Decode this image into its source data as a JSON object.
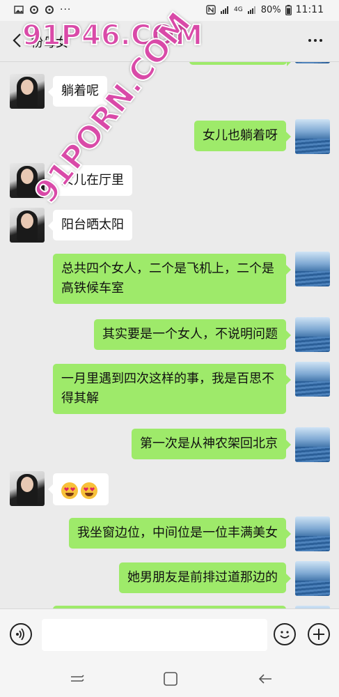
{
  "statusbar": {
    "battery": "80%",
    "time": "11:11",
    "network": "4G"
  },
  "header": {
    "title": "粉母女"
  },
  "messages": [
    {
      "side": "left",
      "text": "躺着呢"
    },
    {
      "side": "right",
      "text": "女儿也躺着呀"
    },
    {
      "side": "left",
      "text": "女儿在厅里"
    },
    {
      "side": "left",
      "text": "阳台晒太阳"
    },
    {
      "side": "right",
      "text": "总共四个女人，二个是飞机上，二个是高铁候车室"
    },
    {
      "side": "right",
      "text": "其实要是一个女人，不说明问题"
    },
    {
      "side": "right",
      "text": "一月里遇到四次这样的事，我是百思不得其解"
    },
    {
      "side": "right",
      "text": "第一次是从神农架回北京"
    },
    {
      "side": "left",
      "emoji": "heart-eyes"
    },
    {
      "side": "right",
      "text": "我坐窗边位，中间位是一位丰满美女"
    },
    {
      "side": "right",
      "text": "她男朋友是前排过道那边的"
    }
  ],
  "watermarks": {
    "top": "91P46.COM",
    "diagonal": "91PORN.COM"
  },
  "colors": {
    "bubble_right": "#9eea6a",
    "bubble_left": "#ffffff",
    "background": "#ebebeb"
  }
}
